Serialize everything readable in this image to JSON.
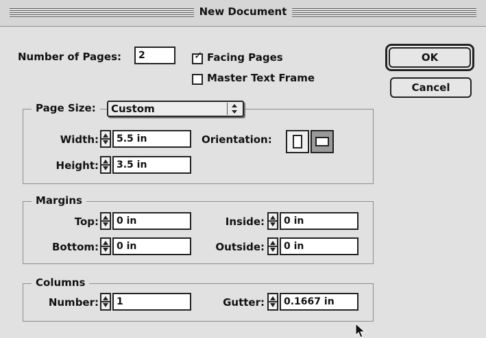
{
  "window": {
    "title": "New Document"
  },
  "top": {
    "num_pages_label": "Number of Pages:",
    "num_pages_value": "2",
    "facing_pages_label": "Facing Pages",
    "facing_pages_checked": true,
    "master_text_frame_label": "Master Text Frame",
    "master_text_frame_checked": false
  },
  "buttons": {
    "ok": "OK",
    "cancel": "Cancel"
  },
  "page_size": {
    "label": "Page Size:",
    "selected": "Custom",
    "width_label": "Width:",
    "width_value": "5.5 in",
    "height_label": "Height:",
    "height_value": "3.5 in",
    "orientation_label": "Orientation:",
    "orientation_selected": "landscape"
  },
  "margins": {
    "title": "Margins",
    "top_label": "Top:",
    "top_value": "0 in",
    "bottom_label": "Bottom:",
    "bottom_value": "0 in",
    "inside_label": "Inside:",
    "inside_value": "0 in",
    "outside_label": "Outside:",
    "outside_value": "0 in"
  },
  "columns": {
    "title": "Columns",
    "number_label": "Number:",
    "number_value": "1",
    "gutter_label": "Gutter:",
    "gutter_value": "0.1667 in"
  },
  "icons": [
    "stepper-arrows-icon",
    "popup-arrows-icon",
    "portrait-icon",
    "landscape-icon",
    "checkmark-icon",
    "arrow-cursor-icon"
  ]
}
